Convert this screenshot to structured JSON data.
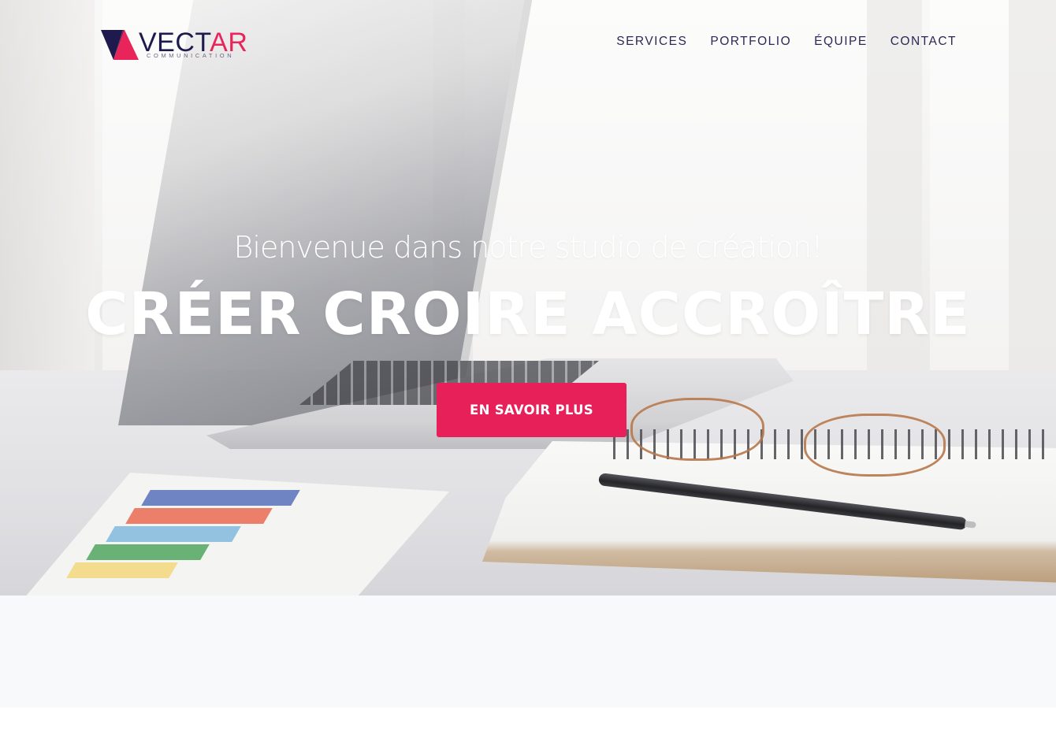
{
  "brand": {
    "name_part1": "VECT",
    "name_part2": "AR",
    "tagline": "COMMUNICATION",
    "colors": {
      "navy": "#1e1a4d",
      "pink": "#e8245a"
    }
  },
  "nav": {
    "items": [
      {
        "label": "SERVICES"
      },
      {
        "label": "PORTFOLIO"
      },
      {
        "label": "ÉQUIPE"
      },
      {
        "label": "CONTACT"
      }
    ]
  },
  "hero": {
    "subtitle": "Bienvenue dans notre studio de création!",
    "headline": "CRÉER CROIRE ACCROÎTRE",
    "cta_label": "EN SAVOIR PLUS",
    "cta_color": "#e7205a",
    "background_image": "desk-laptop-notebook-glasses-photo"
  }
}
